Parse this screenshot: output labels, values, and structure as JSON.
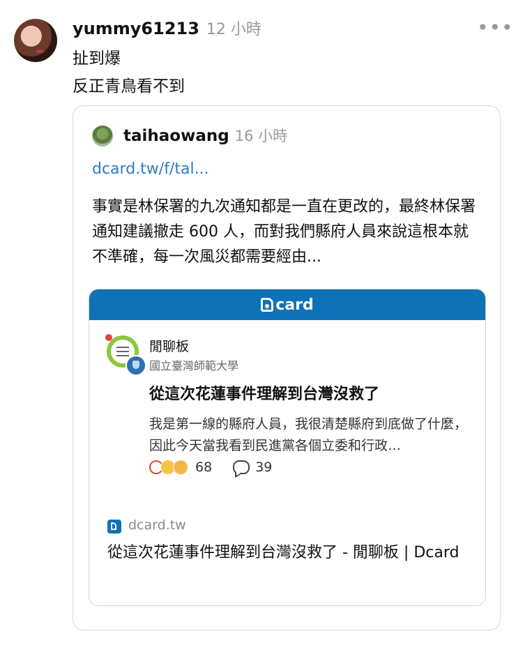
{
  "post": {
    "username": "yummy61213",
    "time": "12 小時",
    "more_icon": "ellipsis-icon",
    "lines": [
      "扯到爆",
      "反正青鳥看不到"
    ]
  },
  "quoted": {
    "username": "taihaowang",
    "time": "16 小時",
    "link": "dcard.tw/f/tal...",
    "body": "事實是林保署的九次通知都是一直在更改的，最終林保署通知建議撤走 600 人，而對我們縣府人員來說這根本就不準確，每一次風災都需要經由..."
  },
  "card": {
    "brand": "card",
    "brand_color": "#0e72b6",
    "forum": "閒聊板",
    "school": "國立臺灣師範大學",
    "title": "從這次花蓮事件理解到台灣沒救了",
    "excerpt": "我是第一線的縣府人員，我很清楚縣府到底做了什麼，因此今天當我看到民進黨各個立委和行政…",
    "reactions": "68",
    "comments": "39",
    "site": "dcard.tw",
    "link_title": "從這次花蓮事件理解到台灣沒救了 - 閒聊板 | Dcard"
  }
}
